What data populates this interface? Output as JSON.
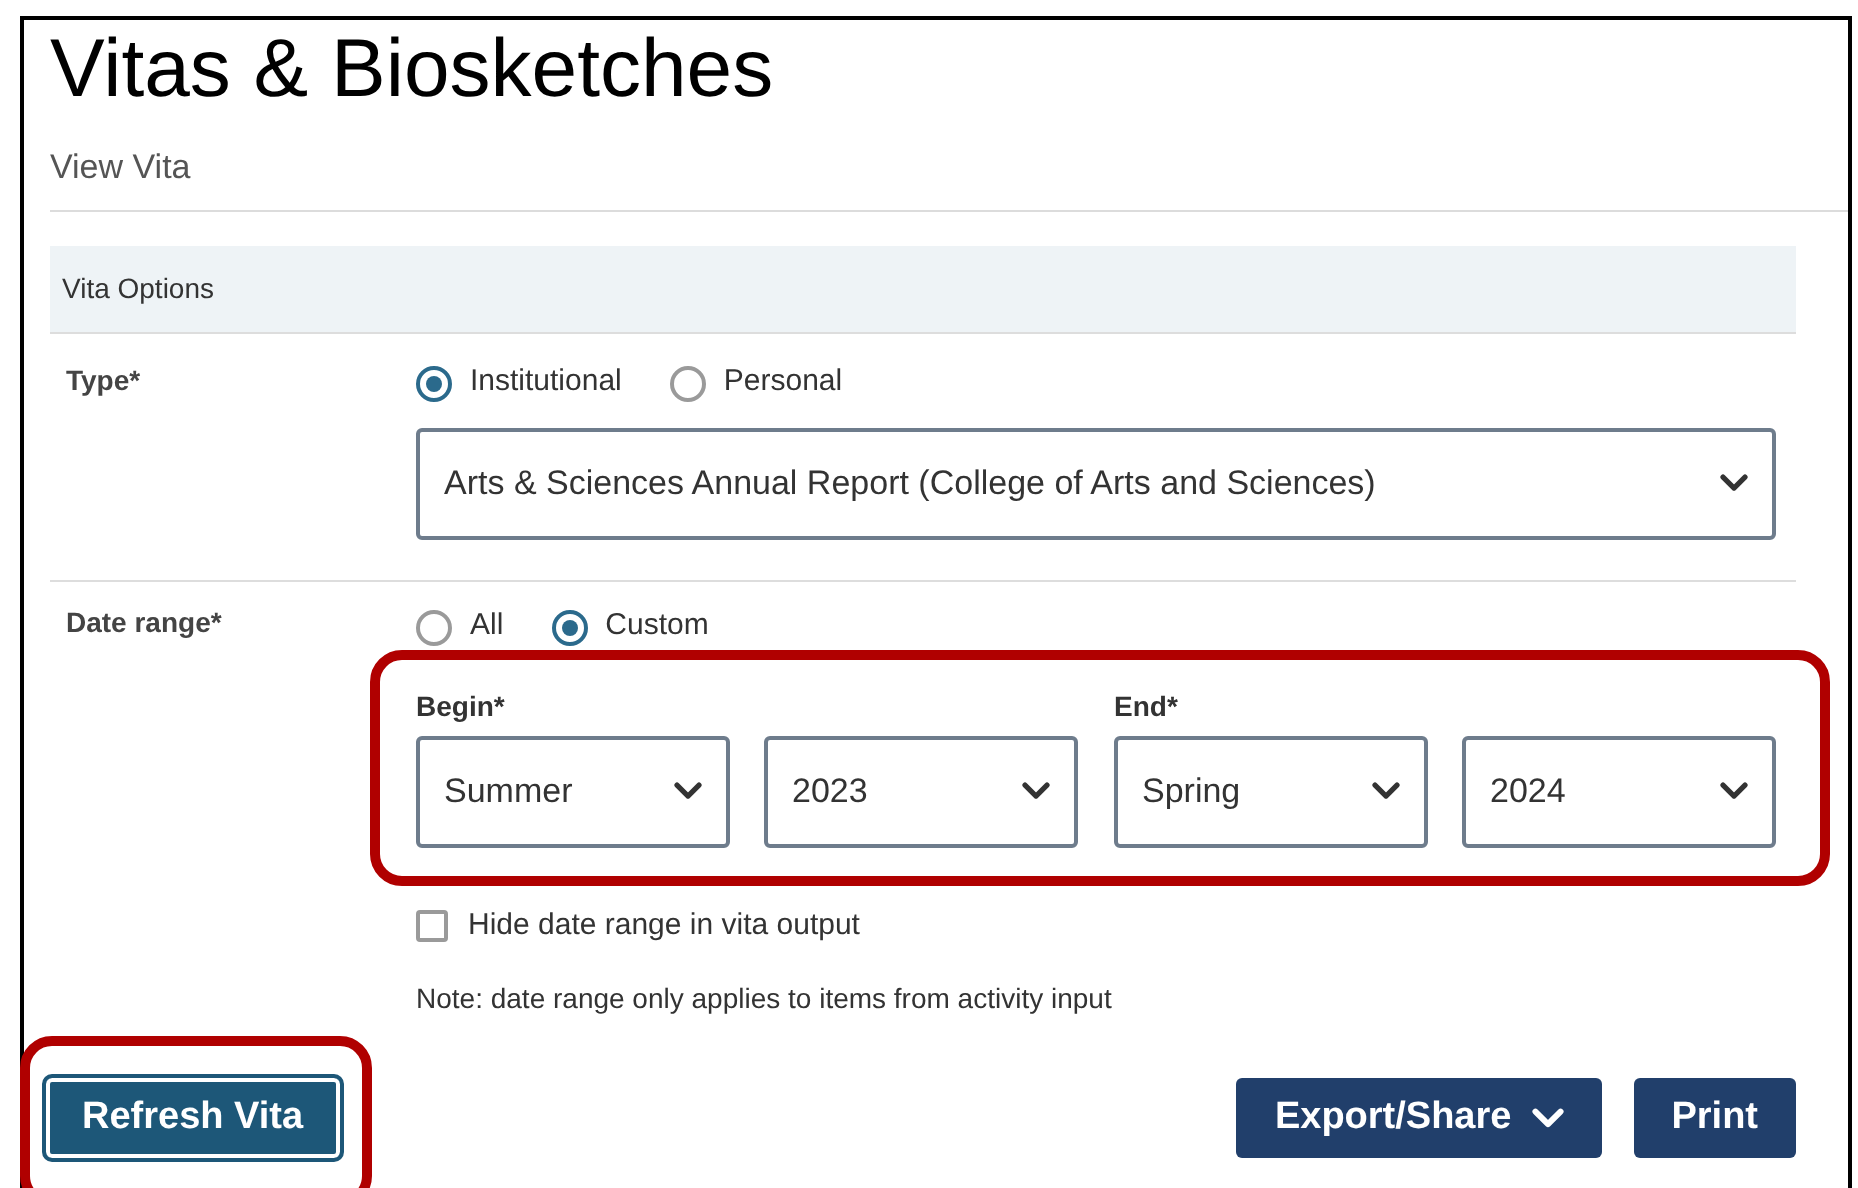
{
  "page": {
    "title": "Vitas & Biosketches",
    "subtitle": "View Vita"
  },
  "section": {
    "title": "Vita Options"
  },
  "type_field": {
    "label": "Type*",
    "options": [
      {
        "label": "Institutional",
        "selected": true
      },
      {
        "label": "Personal",
        "selected": false
      }
    ],
    "select": {
      "value": "Arts & Sciences Annual Report (College of Arts and Sciences)"
    }
  },
  "date_range": {
    "label": "Date range*",
    "options": [
      {
        "label": "All",
        "selected": false
      },
      {
        "label": "Custom",
        "selected": true
      }
    ],
    "highlighted": true,
    "groups": [
      {
        "label": "Begin*",
        "selects": [
          {
            "value": "Summer"
          },
          {
            "value": "2023"
          }
        ]
      },
      {
        "label": "End*",
        "selects": [
          {
            "value": "Spring"
          },
          {
            "value": "2024"
          }
        ]
      }
    ]
  },
  "hide_date_range": {
    "label": "Hide date range in vita output",
    "checked": false
  },
  "note": "Note: date range only applies to items from activity input",
  "buttons": [
    {
      "label": "Refresh Vita",
      "kind": "primary",
      "highlighted": true
    },
    {
      "label": "Export/Share",
      "kind": "menu",
      "highlighted": false
    },
    {
      "label": "Print",
      "kind": "plain",
      "highlighted": false
    }
  ]
}
